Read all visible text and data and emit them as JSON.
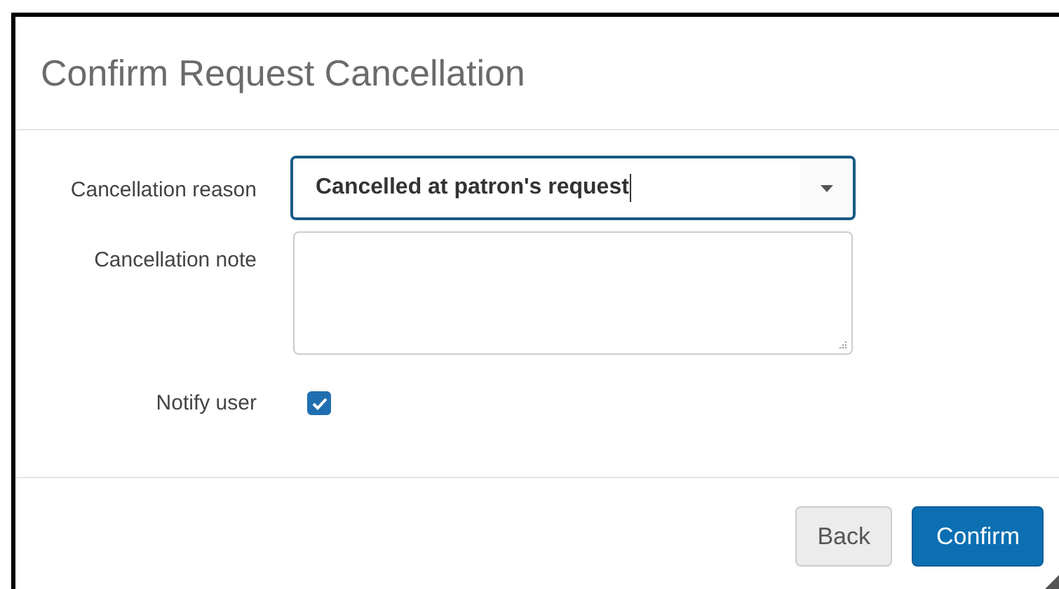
{
  "dialog": {
    "title": "Confirm Request Cancellation",
    "fields": [
      {
        "kind": "select",
        "label": "Cancellation reason",
        "value": "Cancelled at patron's request",
        "focused": true
      },
      {
        "kind": "textarea",
        "label": "Cancellation note"
      },
      {
        "kind": "checkbox",
        "label": "Notify user",
        "checked": true
      }
    ],
    "buttons": [
      {
        "kind": "secondary",
        "label": "Back"
      },
      {
        "kind": "primary",
        "label": "Confirm"
      }
    ]
  }
}
